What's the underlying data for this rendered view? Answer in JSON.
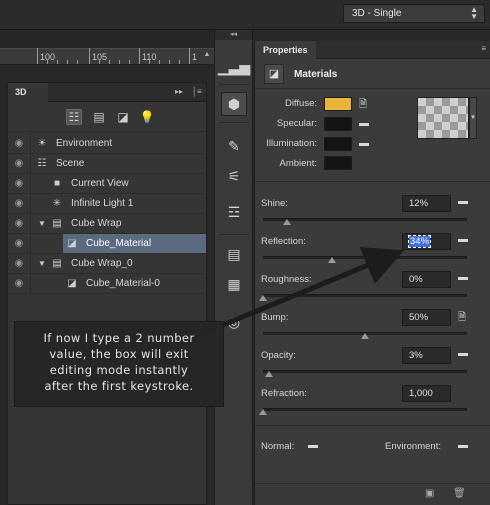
{
  "workspace": {
    "selected": "3D - Single"
  },
  "ruler": {
    "labels": [
      "100",
      "105",
      "110",
      "1"
    ]
  },
  "panel3d": {
    "tab": "3D",
    "tools": [
      "scene-icon",
      "mesh-icon",
      "material-icon",
      "light-icon"
    ],
    "items": [
      {
        "label": "Environment",
        "icon": "environment-icon"
      },
      {
        "label": "Scene",
        "icon": "scene-icon"
      },
      {
        "label": "Current View",
        "icon": "camera-icon"
      },
      {
        "label": "Infinite Light 1",
        "icon": "light-icon"
      },
      {
        "label": "Cube Wrap",
        "icon": "mesh-icon"
      },
      {
        "label": "Cube_Material",
        "icon": "material-icon"
      },
      {
        "label": "Cube Wrap_0",
        "icon": "mesh-icon"
      },
      {
        "label": "Cube_Material-0",
        "icon": "material-icon"
      }
    ]
  },
  "properties": {
    "tab": "Properties",
    "title": "Materials",
    "colors": {
      "diffuse_label": "Diffuse:",
      "specular_label": "Specular:",
      "illumination_label": "Illumination:",
      "ambient_label": "Ambient:",
      "diffuse": "#e8b43a",
      "specular": "#141414",
      "illumination": "#141414",
      "ambient": "#141414"
    },
    "params": [
      {
        "label": "Shine:",
        "value": "12%",
        "level": 0.12
      },
      {
        "label": "Reflection:",
        "value": "34%",
        "level": 0.34
      },
      {
        "label": "Roughness:",
        "value": "0%",
        "level": 0.0
      },
      {
        "label": "Bump:",
        "value": "50%",
        "level": 0.5
      },
      {
        "label": "Opacity:",
        "value": "3%",
        "level": 0.03
      },
      {
        "label": "Refraction:",
        "value": "1,000",
        "level": 0.0
      }
    ],
    "normal_label": "Normal:",
    "environment_label": "Environment:"
  },
  "annotation": {
    "line1": "If now I type a 2 number",
    "line2": "value, the box will exit",
    "line3": "editing mode instantly",
    "line4": "after the first keystroke."
  }
}
